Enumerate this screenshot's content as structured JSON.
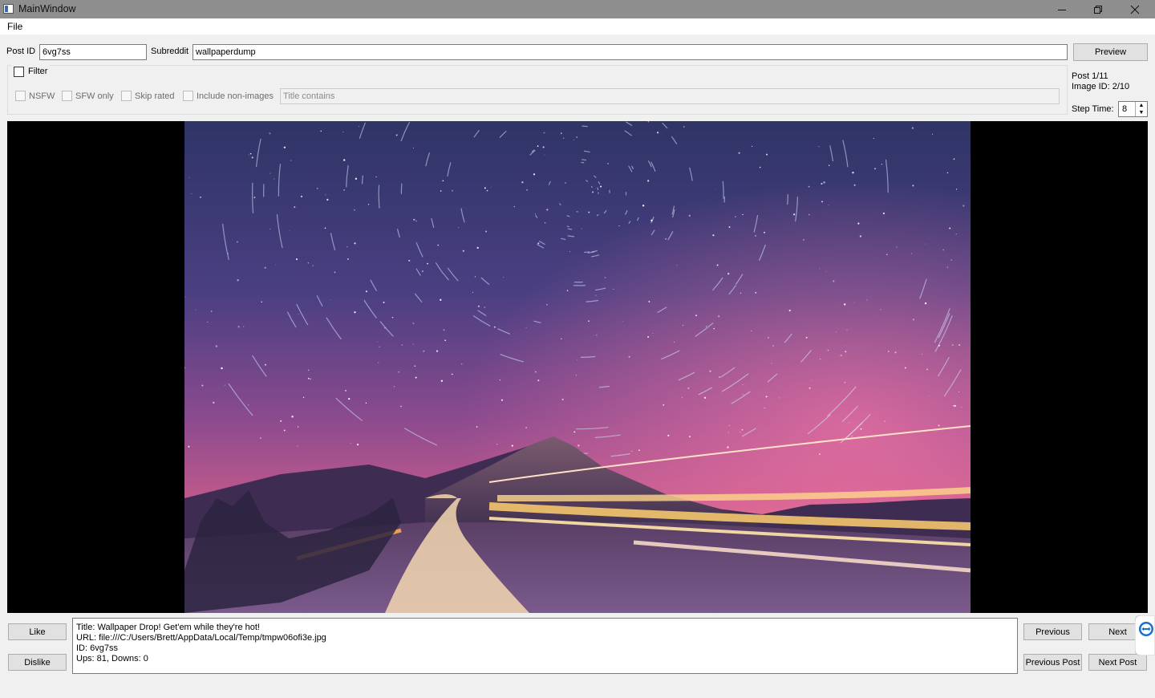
{
  "window": {
    "title": "MainWindow"
  },
  "menu": {
    "file": "File"
  },
  "top": {
    "post_id_label": "Post ID",
    "post_id_value": "6vg7ss",
    "subreddit_label": "Subreddit",
    "subreddit_value": "wallpaperdump",
    "preview_label": "Preview"
  },
  "filter": {
    "title": "Filter",
    "nsfw": "NSFW",
    "sfw_only": "SFW only",
    "skip_rated": "Skip rated",
    "include_non_images": "Include non-images",
    "title_contains_placeholder": "Title contains"
  },
  "status": {
    "post": "Post 1/11",
    "image_id": "Image ID: 2/10",
    "step_time_label": "Step Time:",
    "step_time_value": "8"
  },
  "viewer": {
    "image": "night-sky-star-trails-road-photo"
  },
  "actions": {
    "like": "Like",
    "dislike": "Dislike",
    "previous": "Previous",
    "next": "Next",
    "previous_post": "Previous Post",
    "next_post": "Next Post"
  },
  "info": {
    "title_line": "Title: Wallpaper Drop! Get'em while they're hot!",
    "url_line": "URL: file:///C:/Users/Brett/AppData/Local/Temp/tmpw06ofi3e.jpg",
    "id_line": "ID: 6vg7ss",
    "votes_line": "Ups: 81, Downs: 0"
  },
  "colors": {
    "titlebar": "#8e8e8e",
    "viewer_bg": "#000000",
    "window_bg": "#f0f0f0"
  }
}
